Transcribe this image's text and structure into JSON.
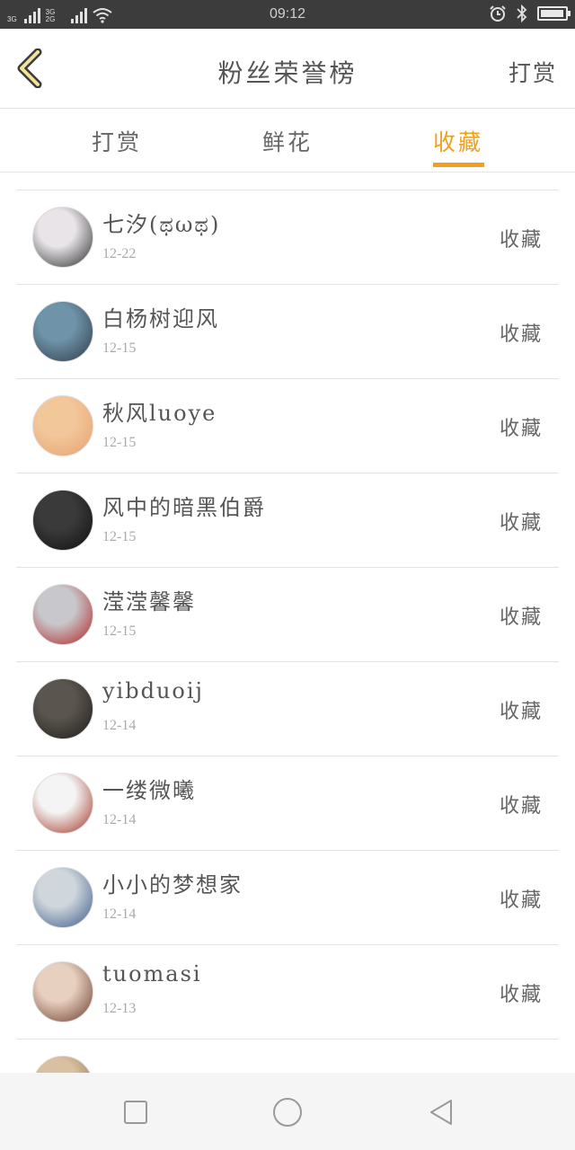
{
  "status_bar": {
    "network_1": "3G",
    "network_2": "3G 2G",
    "time": "09:12",
    "battery_level": 0.95,
    "icons": [
      "signal-icon",
      "wifi-icon",
      "alarm-icon",
      "bluetooth-icon",
      "battery-icon"
    ]
  },
  "header": {
    "title": "粉丝荣誉榜",
    "action": "打赏"
  },
  "tabs": [
    {
      "label": "打赏",
      "active": false
    },
    {
      "label": "鲜花",
      "active": false
    },
    {
      "label": "收藏",
      "active": true
    }
  ],
  "accent_color": "#f0a020",
  "list": [
    {
      "name": "七汐(ಥωಥ)",
      "date": "12-22",
      "action": "收藏",
      "avatar_colors": [
        "#e8e4e8",
        "#2a2a2a"
      ]
    },
    {
      "name": "白杨树迎风",
      "date": "12-15",
      "action": "收藏",
      "avatar_colors": [
        "#6f93a8",
        "#2d3a48"
      ]
    },
    {
      "name": "秋风luoye",
      "date": "12-15",
      "action": "收藏",
      "avatar_colors": [
        "#f2c89a",
        "#e8a070"
      ]
    },
    {
      "name": "风中的暗黑伯爵",
      "date": "12-15",
      "action": "收藏",
      "avatar_colors": [
        "#3a3a3a",
        "#101010"
      ]
    },
    {
      "name": "滢滢馨馨",
      "date": "12-15",
      "action": "收藏",
      "avatar_colors": [
        "#c8c8cc",
        "#b02020"
      ]
    },
    {
      "name": "yibduoij",
      "date": "12-14",
      "action": "收藏",
      "avatar_colors": [
        "#5a554e",
        "#1e1c1a"
      ]
    },
    {
      "name": "一缕微曦",
      "date": "12-14",
      "action": "收藏",
      "avatar_colors": [
        "#f4f4f4",
        "#a03020"
      ]
    },
    {
      "name": "小小的梦想家",
      "date": "12-14",
      "action": "收藏",
      "avatar_colors": [
        "#cfd6dc",
        "#3a5a8a"
      ]
    },
    {
      "name": "tuomasi",
      "date": "12-13",
      "action": "收藏",
      "avatar_colors": [
        "#e8d0c0",
        "#6a3a2a"
      ]
    },
    {
      "name": "",
      "date": "",
      "action": "",
      "avatar_colors": [
        "#d8c0a0",
        "#8a6a4a"
      ]
    }
  ]
}
